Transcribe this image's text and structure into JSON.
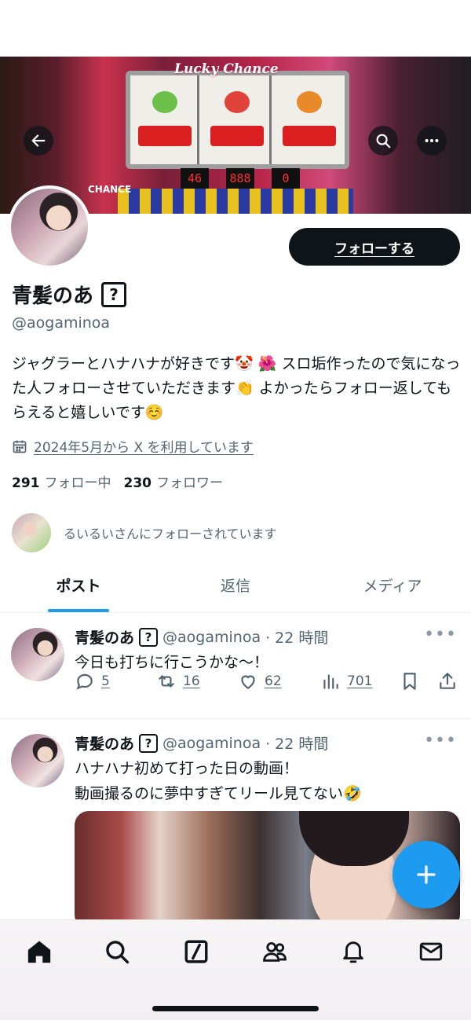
{
  "banner": {
    "logo_text": "Lucky Chance",
    "counters": [
      "46",
      "888",
      "0"
    ],
    "chance_label": "CHANCE"
  },
  "profile": {
    "name": "青髪のあ",
    "badge": "?",
    "handle": "@aogaminoa",
    "follow_label": "フォローする",
    "bio": "ジャグラーとハナハナが好きです🤡 🌺 スロ垢作ったので気になった人フォローさせていただきます👏 よかったらフォロー返してもらえると嬉しいです☺️",
    "joined": "2024年5月から X を利用しています",
    "following_count": "291",
    "following_label": "フォロー中",
    "followers_count": "230",
    "followers_label": "フォロワー",
    "followed_by": "るいるいさんにフォローされています"
  },
  "tabs": [
    {
      "label": "ポスト",
      "active": true
    },
    {
      "label": "返信",
      "active": false
    },
    {
      "label": "メディア",
      "active": false
    }
  ],
  "posts": [
    {
      "name": "青髪のあ",
      "handle": "@aogaminoa",
      "time": "· 22 時間",
      "text": "今日も打ちに行こうかな〜！",
      "replies": "5",
      "reposts": "16",
      "likes": "62",
      "views": "701"
    },
    {
      "name": "青髪のあ",
      "handle": "@aogaminoa",
      "time": "· 22 時間",
      "text_line1": "ハナハナ初めて打った日の動画！",
      "text_line2": "動画撮るのに夢中すぎてリール見てない🤣"
    }
  ],
  "colors": {
    "accent": "#1d9bf0",
    "text_primary": "#0f1419",
    "text_secondary": "#536471",
    "follow_button": "#0f1419"
  },
  "icons": {
    "nav": [
      "home-icon",
      "search-icon",
      "compose-slash-icon",
      "communities-icon",
      "bell-icon",
      "mail-icon"
    ],
    "header": [
      "back-arrow-icon",
      "search-icon",
      "more-icon"
    ],
    "fab": "plus-icon"
  }
}
